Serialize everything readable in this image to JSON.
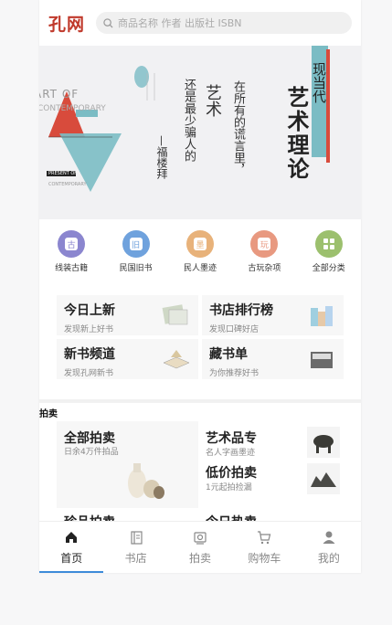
{
  "header": {
    "logo": "孔网",
    "search_placeholder": "商品名称 作者 出版社 ISBN"
  },
  "banner": {
    "art_title": "艺术理论",
    "badge": "现当代",
    "art_text": "艺术",
    "quote_1": "在所有的谎言里，",
    "quote_2": "还是最少骗人的",
    "author": "—福楼拜",
    "art_of": "ART OF",
    "contemporary": "CONTEMPORARY",
    "present_of": "PRESENT OF",
    "contemporary_small": "CONTEMPORARY"
  },
  "categories": [
    {
      "label": "线装古籍",
      "glyph": "古",
      "color": "#8b86cf"
    },
    {
      "label": "民国旧书",
      "glyph": "旧",
      "color": "#6fa2dd"
    },
    {
      "label": "民人墨迹",
      "glyph": "墨",
      "color": "#e8b27a"
    },
    {
      "label": "古玩杂项",
      "glyph": "玩",
      "color": "#e89980"
    },
    {
      "label": "全部分类",
      "glyph": "",
      "color": "#9cc06e"
    }
  ],
  "cards": [
    {
      "title": "今日上新",
      "subtitle": "发现新上好书"
    },
    {
      "title": "书店排行榜",
      "subtitle": "发现口碑好店"
    },
    {
      "title": "新书频道",
      "subtitle": "发现孔网新书"
    },
    {
      "title": "藏书单",
      "subtitle": "为你推荐好书"
    }
  ],
  "auction_section": {
    "title": "拍卖",
    "all": {
      "title": "全部拍卖",
      "subtitle": "日余4万件拍品"
    },
    "art": {
      "title": "艺术品专",
      "subtitle": "名人字画墨迹"
    },
    "low": {
      "title": "低价拍卖",
      "subtitle": "1元起拍捡漏"
    },
    "more_left": "珍品拍卖",
    "more_right": "今日热卖"
  },
  "nav": [
    {
      "label": "首页",
      "icon": "home-icon"
    },
    {
      "label": "书店",
      "icon": "bookstore-icon"
    },
    {
      "label": "拍卖",
      "icon": "auction-icon"
    },
    {
      "label": "购物车",
      "icon": "cart-icon"
    },
    {
      "label": "我的",
      "icon": "user-icon"
    }
  ]
}
